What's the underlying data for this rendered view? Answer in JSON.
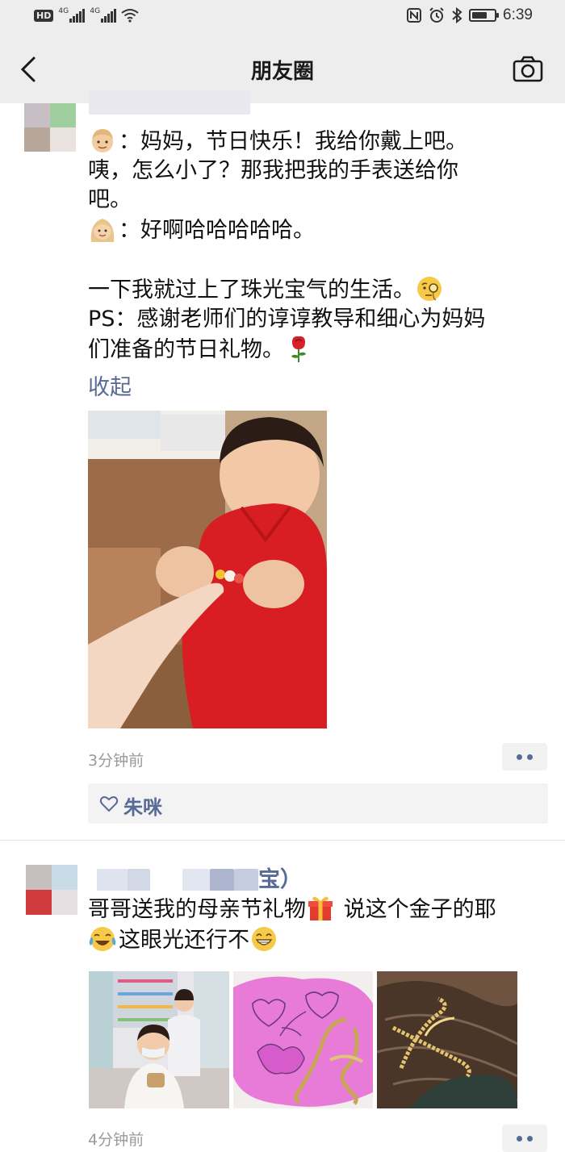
{
  "status_bar": {
    "hd_label": "HD",
    "signal_labels": [
      "4G",
      "4G"
    ],
    "time": "6:39",
    "battery_level_percent": 70
  },
  "nav": {
    "title": "朋友圈",
    "back_icon": "chevron-left-icon",
    "camera_icon": "camera-icon"
  },
  "posts": [
    {
      "lines": [
        {
          "emoji": "boy-emoji",
          "text": "：妈妈，节日快乐！我给你戴上吧。"
        },
        {
          "emoji": "",
          "text": "咦，怎么小了？那我把我的手表送给你"
        },
        {
          "emoji": "",
          "text": "吧。"
        },
        {
          "emoji": "woman-emoji",
          "text": "：好啊哈哈哈哈哈。"
        },
        {
          "emoji": "",
          "text": ""
        },
        {
          "emoji": "",
          "text": "一下我就过上了珠光宝气的生活。",
          "trailing_emoji": "monocle-face-emoji"
        },
        {
          "emoji": "",
          "text": "PS：感谢老师们的谆谆教导和细心为妈妈"
        },
        {
          "emoji": "",
          "text": "们准备的节日礼物。",
          "trailing_emoji": "rose-emoji"
        }
      ],
      "fold_label": "收起",
      "time": "3分钟前",
      "likes": [
        "朱咪"
      ]
    },
    {
      "nickname_visible": "宝）",
      "lines": [
        {
          "text": "哥哥送我的母亲节礼物",
          "trailing_emoji": "gift-emoji",
          "after": " 说这个金子的耶"
        },
        {
          "emoji": "crying-laughing-emoji",
          "text": "这眼光还行不",
          "trailing_emoji": "grinning-face-emoji"
        }
      ],
      "time": "4分钟前"
    }
  ],
  "colors": {
    "link": "#576b95",
    "bar_bg": "#ededed",
    "text": "#111111",
    "meta": "#9a9a9a"
  }
}
